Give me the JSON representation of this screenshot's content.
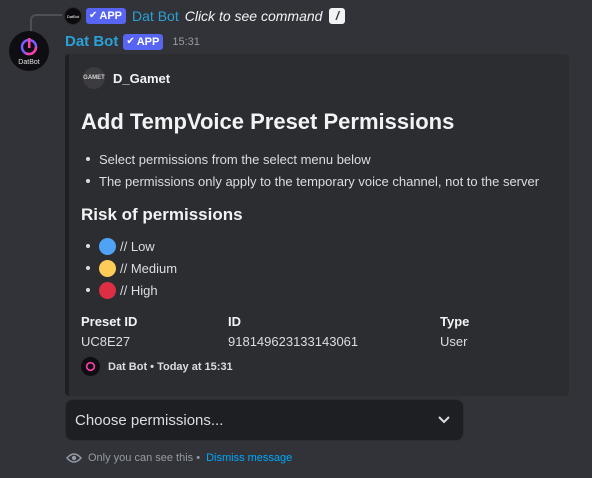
{
  "reply": {
    "app_badge": "APP",
    "bot_name": "Dat Bot",
    "command_text": "Click to see command",
    "mini_avatar_text": "DatBot"
  },
  "message": {
    "avatar_label": "DatBot",
    "username": "Dat Bot",
    "app_badge": "APP",
    "timestamp": "15:31"
  },
  "embed": {
    "author_icon_text": "GAMET",
    "author_name": "D_Gamet",
    "title": "Add TempVoice Preset Permissions",
    "bullets": [
      "Select permissions from the select menu below",
      "The permissions only apply to the temporary voice channel, not to the server"
    ],
    "risk_title": "Risk of permissions",
    "risks": [
      {
        "label": "// Low",
        "color": "#4fa3f7"
      },
      {
        "label": "// Medium",
        "color": "#fdcb58"
      },
      {
        "label": "// High",
        "color": "#dd2e44"
      }
    ],
    "fields": [
      {
        "name": "Preset ID",
        "value": "UC8E27"
      },
      {
        "name": "ID",
        "value": "918149623133143061"
      },
      {
        "name": "Type",
        "value": "User"
      }
    ],
    "footer": "Dat Bot • Today at 15:31"
  },
  "select_menu": {
    "placeholder": "Choose permissions..."
  },
  "ephemeral": {
    "notice": "Only you can see this •",
    "dismiss": "Dismiss message"
  },
  "colors": {
    "background": "#323339",
    "embed_bg": "#2b2d31",
    "accent_blurple": "#5865f2",
    "username": "#2aa1d6",
    "link": "#00a8fc"
  }
}
